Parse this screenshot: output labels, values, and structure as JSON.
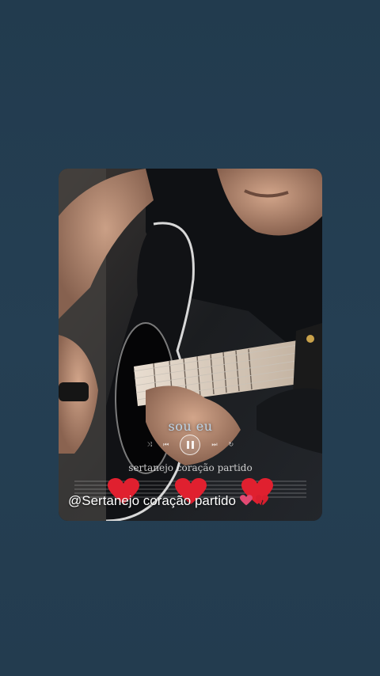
{
  "post": {
    "song_title": "sou eu",
    "subtitle": "sertanejo coração partido",
    "mention": "@Sertanejo coração partido",
    "player": {
      "shuffle_icon": "shuffle-icon",
      "prev_icon": "previous-icon",
      "pause_icon": "pause-icon",
      "next_icon": "next-icon",
      "repeat_icon": "repeat-icon"
    },
    "hearts": [
      "red-heart-icon",
      "red-heart-icon",
      "red-heart-icon"
    ],
    "mention_emojis": [
      "pink-heart-icon",
      "broken-heart-icon"
    ],
    "colors": {
      "background": "#233c4f",
      "heart": "#e0202f",
      "title": "#bcd4e8"
    }
  }
}
